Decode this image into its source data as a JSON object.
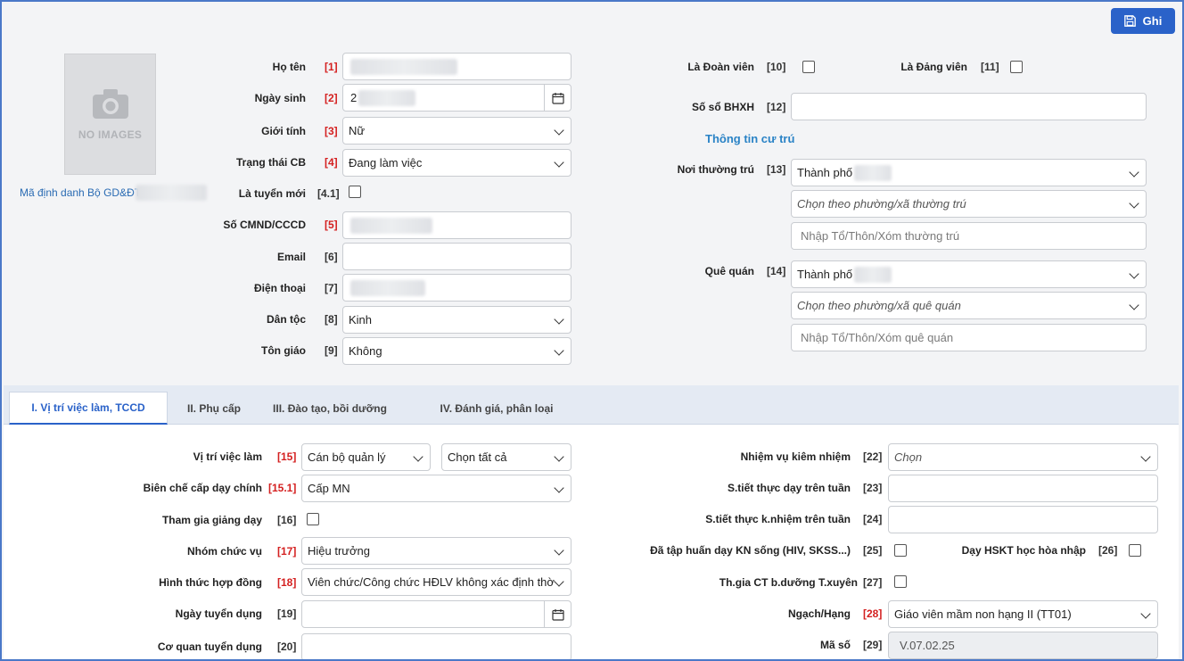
{
  "toolbar": {
    "save_label": "Ghi",
    "save_icon": "floppy-disk-icon"
  },
  "photo": {
    "placeholder_text": "NO IMAGES",
    "icon": "camera-icon"
  },
  "profile": {
    "ma_dinh_danh_label": "Mã định danh Bộ GD&ĐT:"
  },
  "left_fields": {
    "ho_ten": {
      "label": "Họ tên",
      "num": "[1]"
    },
    "ngay_sinh": {
      "label": "Ngày sinh",
      "num": "[2]",
      "value": "2"
    },
    "gioi_tinh": {
      "label": "Giới tính",
      "num": "[3]",
      "value": "Nữ"
    },
    "trang_thai": {
      "label": "Trạng thái CB",
      "num": "[4]",
      "value": "Đang làm việc"
    },
    "tuyen_moi": {
      "label": "Là tuyển mới",
      "num": "[4.1]"
    },
    "cmnd": {
      "label": "Số CMND/CCCD",
      "num": "[5]"
    },
    "email": {
      "label": "Email",
      "num": "[6]"
    },
    "dien_thoai": {
      "label": "Điện thoại",
      "num": "[7]"
    },
    "dan_toc": {
      "label": "Dân tộc",
      "num": "[8]",
      "value": "Kinh"
    },
    "ton_giao": {
      "label": "Tôn giáo",
      "num": "[9]",
      "value": "Không"
    }
  },
  "right_fields": {
    "doan_vien": {
      "label": "Là Đoàn viên",
      "num": "[10]"
    },
    "dang_vien": {
      "label": "Là Đảng viên",
      "num": "[11]"
    },
    "bhxh": {
      "label": "Số sổ BHXH",
      "num": "[12]"
    },
    "cu_tru_title": "Thông tin cư trú",
    "thuong_tru": {
      "label": "Nơi thường trú",
      "num": "[13]",
      "city": "Thành phố",
      "ward_placeholder": "Chọn theo phường/xã thường trú",
      "street_placeholder": "Nhập Tổ/Thôn/Xóm thường trú"
    },
    "que_quan": {
      "label": "Quê quán",
      "num": "[14]",
      "city": "Thành phố",
      "ward_placeholder": "Chọn theo phường/xã quê quán",
      "street_placeholder": "Nhập Tổ/Thôn/Xóm quê quán"
    }
  },
  "tabs": [
    {
      "label": "I. Vị trí việc làm, TCCD",
      "active": true
    },
    {
      "label": "II. Phụ cấp",
      "active": false
    },
    {
      "label": "III. Đào tạo, bồi dưỡng",
      "active": false
    },
    {
      "label": "IV. Đánh giá, phân loại",
      "active": false
    }
  ],
  "job_left": {
    "vi_tri": {
      "label": "Vị trí việc làm",
      "num": "[15]",
      "value1": "Cán bộ quản lý",
      "value2": "Chọn tất cả"
    },
    "bien_che": {
      "label": "Biên chế cấp dạy chính",
      "num": "[15.1]",
      "value": "Cấp MN"
    },
    "giang_day": {
      "label": "Tham gia giảng dạy",
      "num": "[16]"
    },
    "nhom_chuc_vu": {
      "label": "Nhóm chức vụ",
      "num": "[17]",
      "value": "Hiệu trưởng"
    },
    "hop_dong": {
      "label": "Hình thức hợp đồng",
      "num": "[18]",
      "value": "Viên chức/Công chức HĐLV không xác định thờ"
    },
    "ngay_tuyen": {
      "label": "Ngày tuyển dụng",
      "num": "[19]"
    },
    "co_quan": {
      "label": "Cơ quan tuyển dụng",
      "num": "[20]"
    }
  },
  "job_right": {
    "kiem_nhiem": {
      "label": "Nhiệm vụ kiêm nhiệm",
      "num": "[22]",
      "placeholder": "Chọn"
    },
    "tiet_day": {
      "label": "S.tiết thực dạy trên tuần",
      "num": "[23]"
    },
    "tiet_kn": {
      "label": "S.tiết thực k.nhiệm trên tuần",
      "num": "[24]"
    },
    "tap_huan": {
      "label": "Đã tập huấn dạy KN sống (HIV, SKSS...)",
      "num": "[25]"
    },
    "hskt": {
      "label": "Dạy HSKT học hòa nhập",
      "num": "[26]"
    },
    "boi_duong": {
      "label": "Th.gia CT b.dưỡng T.xuyên",
      "num": "[27]"
    },
    "ngach": {
      "label": "Ngạch/Hạng",
      "num": "[28]",
      "value": "Giáo viên mầm non hạng II (TT01)"
    },
    "ma_so": {
      "label": "Mã số",
      "num": "[29]",
      "value": "V.07.02.25"
    }
  },
  "colors": {
    "accent": "#2a62c9",
    "required": "#d42020",
    "link": "#2a6bb3"
  }
}
